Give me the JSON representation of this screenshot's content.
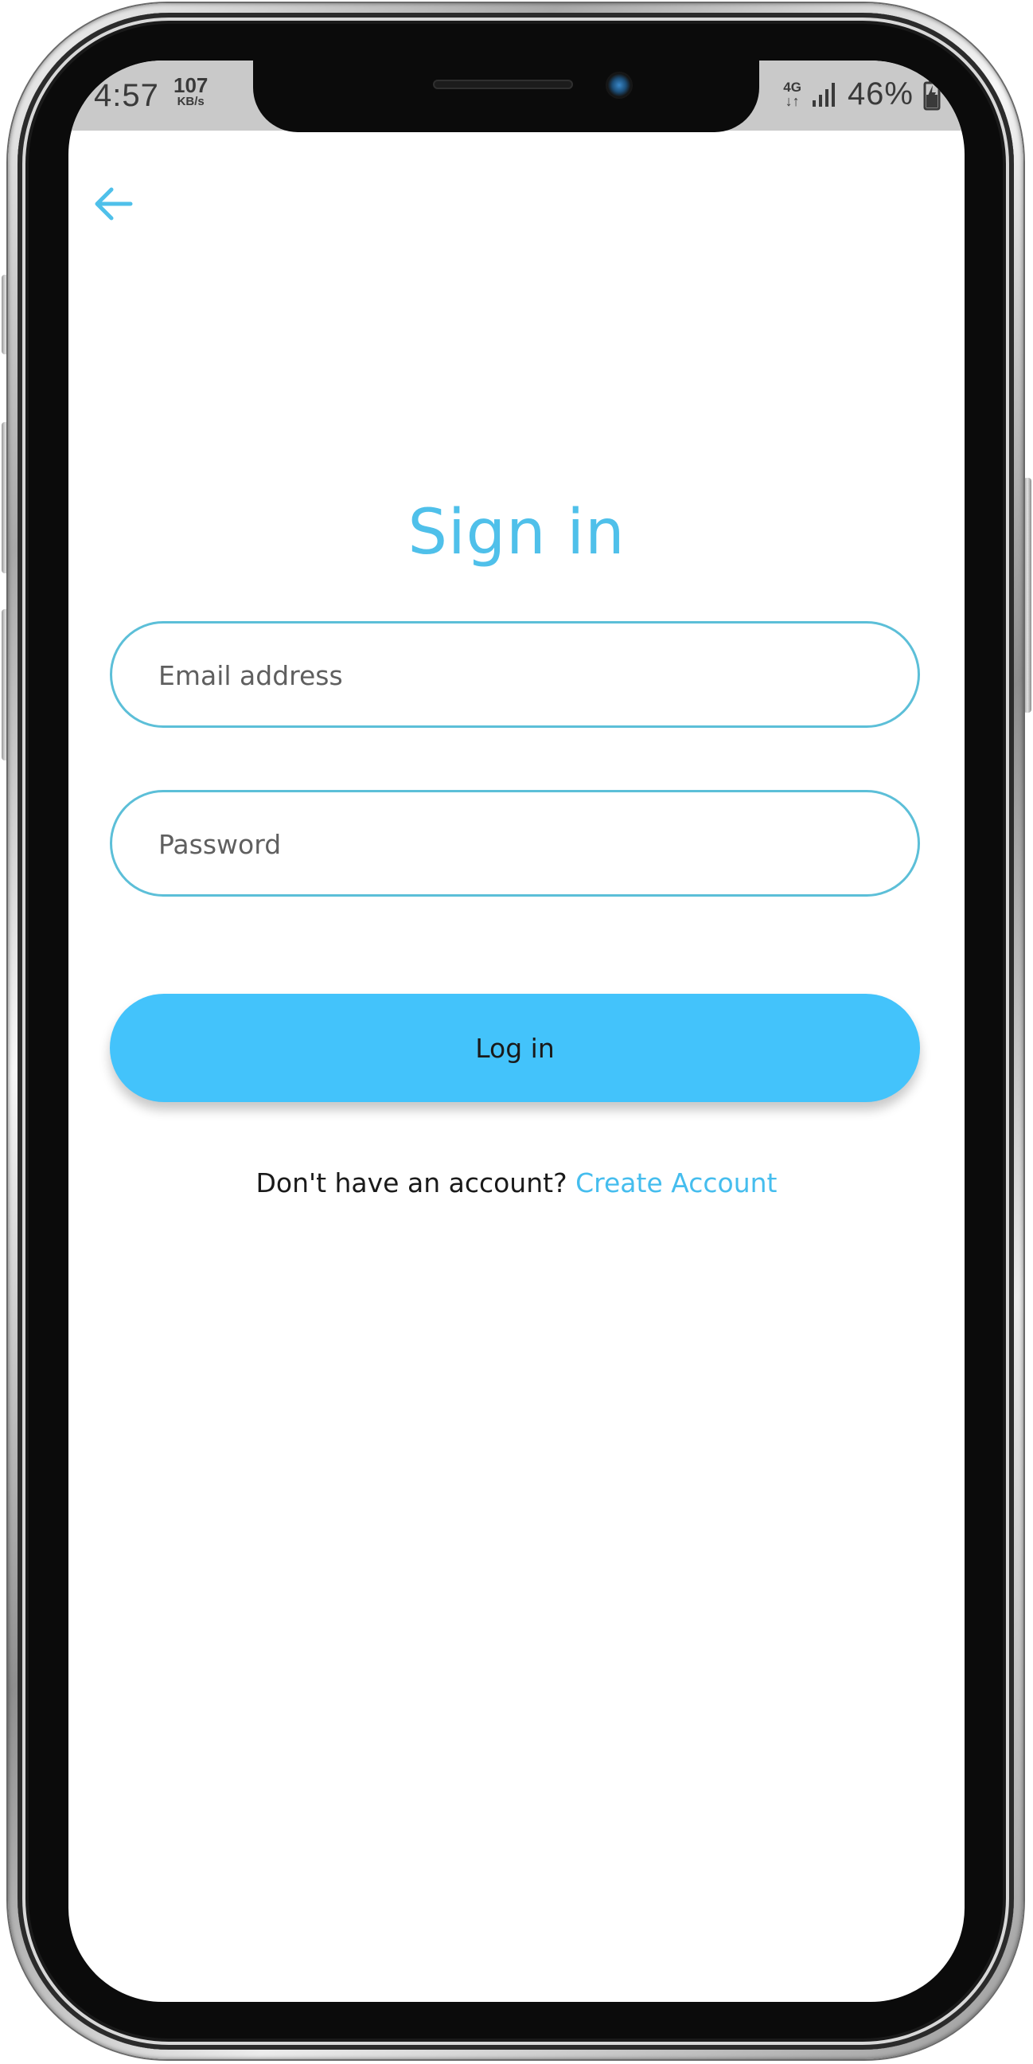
{
  "status_bar": {
    "time": "4:57",
    "net_speed_value": "107",
    "net_speed_unit": "KB/s",
    "network_type": "4G",
    "network_arrows": "↓↑",
    "battery": "46%"
  },
  "header": {
    "back_icon": "arrow-left-icon"
  },
  "screen": {
    "title": "Sign in"
  },
  "form": {
    "email_placeholder": "Email address",
    "email_value": "",
    "password_placeholder": "Password",
    "password_value": "",
    "login_label": "Log in"
  },
  "footer": {
    "prompt": "Don't have an account?",
    "link": "Create Account"
  },
  "colors": {
    "accent": "#4fc0ea",
    "button": "#43c3fb",
    "field_border": "#5cbfd8"
  }
}
